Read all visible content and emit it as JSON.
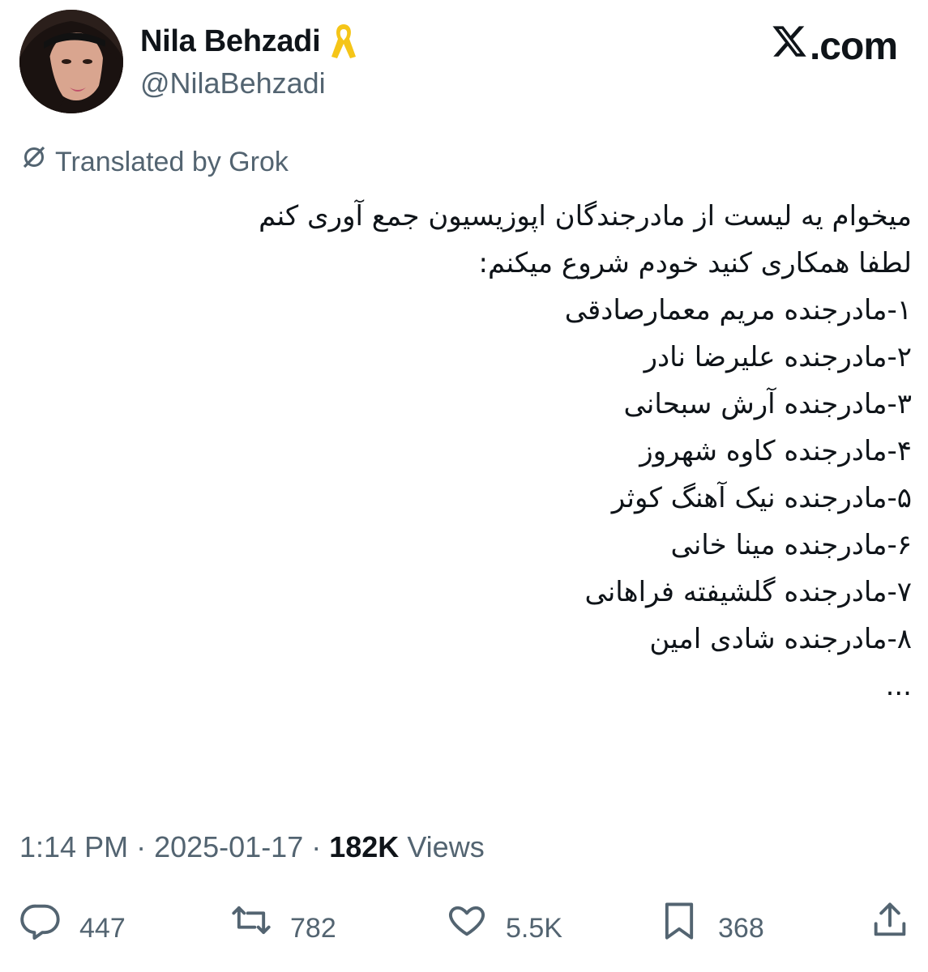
{
  "author": {
    "name": "Nila Behzadi",
    "handle": "@NilaBehzadi"
  },
  "site": {
    "label": ".com"
  },
  "translation": {
    "label": "Translated by Grok"
  },
  "tweet_lines": [
    "میخوام یه لیست از مادرجندگان اپوزیسیون جمع آوری کنم",
    "لطفا همکاری کنید خودم شروع میکنم:",
    "۱-مادرجنده مریم معمارصادقی",
    "۲-مادرجنده علیرضا نادر",
    "۳-مادرجنده آرش سبحانی",
    "۴-مادرجنده کاوه شهروز",
    "۵-مادرجنده نیک آهنگ کوثر",
    "۶-مادرجنده مینا خانی",
    "۷-مادرجنده گلشیفته فراهانی",
    "۸-مادرجنده شادی امین",
    "..."
  ],
  "meta": {
    "time": "1:14 PM",
    "date": "2025-01-17",
    "views_count": "182K",
    "views_label": "Views",
    "separator": " · "
  },
  "actions": {
    "replies": "447",
    "reposts": "782",
    "likes": "5.5K",
    "bookmarks": "368"
  },
  "colors": {
    "text": "#0f1419",
    "secondary": "#536471",
    "ribbon": "#f5c518"
  },
  "icons": [
    "ribbon-icon",
    "x-logo-icon",
    "translate-icon",
    "reply-icon",
    "repost-icon",
    "like-icon",
    "bookmark-icon",
    "share-icon"
  ]
}
